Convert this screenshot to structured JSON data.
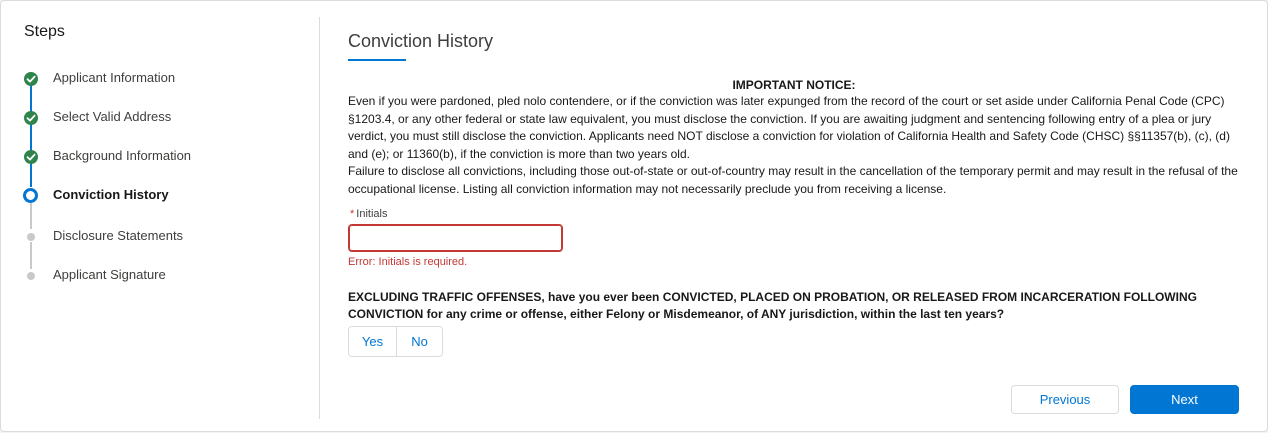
{
  "sidebar": {
    "title": "Steps",
    "steps": [
      {
        "label": "Applicant Information",
        "status": "complete"
      },
      {
        "label": "Select Valid Address",
        "status": "complete"
      },
      {
        "label": "Background Information",
        "status": "complete"
      },
      {
        "label": "Conviction History",
        "status": "current"
      },
      {
        "label": "Disclosure Statements",
        "status": "pending"
      },
      {
        "label": "Applicant Signature",
        "status": "pending"
      }
    ]
  },
  "main": {
    "title": "Conviction History",
    "notice": {
      "heading": "IMPORTANT NOTICE:",
      "paragraph1": "Even if you were pardoned, pled nolo contendere, or if the conviction was later expunged from the record of the court or set aside under California Penal Code (CPC) §1203.4, or any other federal or state law equivalent, you must disclose the conviction. If you are awaiting judgment and sentencing following entry of a plea or jury verdict, you must still disclose the conviction. Applicants need NOT disclose a conviction for violation of California Health and Safety Code (CHSC) §§11357(b), (c), (d) and (e); or 11360(b), if the conviction is more than two years old.",
      "paragraph2": "Failure to disclose all convictions, including those out-of-state or out-of-country may result in the cancellation of the temporary permit and may result in the refusal of the occupational license. Listing all conviction information may not necessarily preclude you from receiving a license."
    },
    "initials": {
      "required_marker": "*",
      "label": "Initials",
      "value": "",
      "placeholder": "",
      "error": "Error: Initials is required."
    },
    "question": "EXCLUDING TRAFFIC OFFENSES, have you ever been CONVICTED, PLACED ON PROBATION, OR RELEASED FROM INCARCERATION FOLLOWING CONVICTION for any crime or offense, either Felony or Misdemeanor, of ANY jurisdiction, within the last ten years?",
    "answer_options": {
      "yes": "Yes",
      "no": "No"
    }
  },
  "footer": {
    "previous_label": "Previous",
    "next_label": "Next"
  },
  "colors": {
    "brand_blue": "#0176d3",
    "success_green": "#2e844a",
    "error_red": "#c23934",
    "pending_grey": "#c9c9c9",
    "border": "#dddbda"
  },
  "icons": {
    "complete": "check-icon",
    "current": "current-step-ring-icon",
    "pending": "pending-dot-icon"
  }
}
